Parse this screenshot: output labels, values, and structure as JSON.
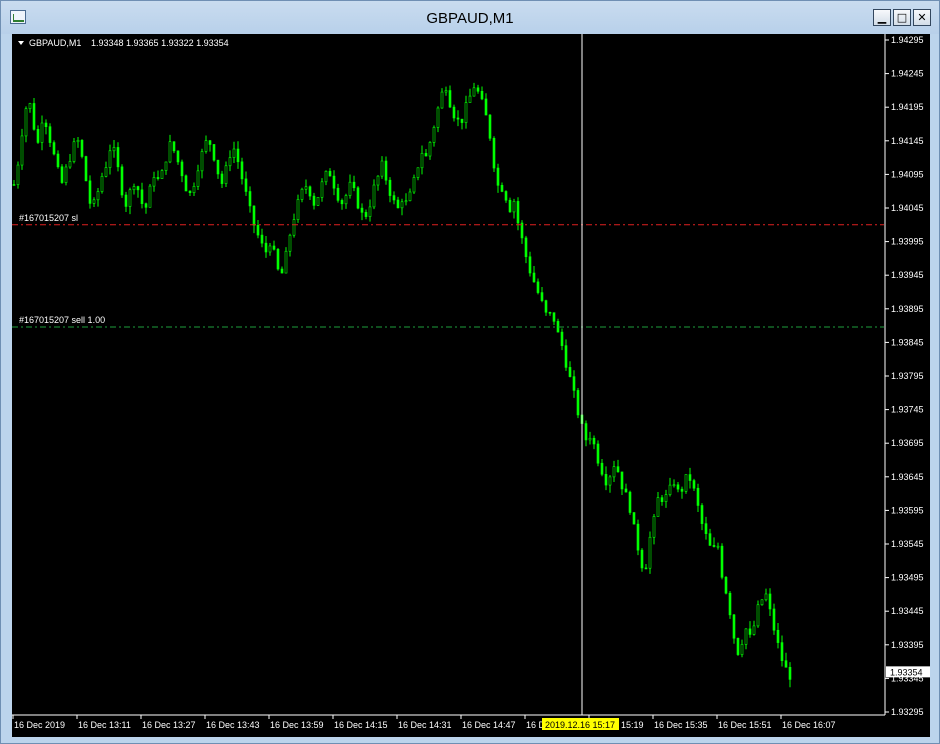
{
  "window": {
    "title": "GBPAUD,M1",
    "buttons": {
      "minimize": "▁",
      "maximize": "□",
      "close": "✕"
    }
  },
  "chart_header": {
    "symbol": "GBPAUD,M1",
    "ohlc": "1.93348 1.93365 1.93322 1.93354"
  },
  "order_lines": {
    "stop_loss": {
      "label": "#167015207 sl",
      "price": 1.9402,
      "color": "#e02020"
    },
    "entry": {
      "label": "#167015207 sell 1.00",
      "price": 1.93868,
      "color": "#1e9e3c"
    }
  },
  "crosshair": {
    "time_label": "2019.12.16 15:17",
    "label_bg": "#ffff00"
  },
  "bid_label": {
    "value": "1.93354"
  },
  "colors": {
    "background": "#000000",
    "candle": "#00ff00",
    "axis_text": "#ffffff",
    "crosshair": "#ffffff"
  },
  "chart_data": {
    "type": "candlestick",
    "symbol": "GBPAUD",
    "timeframe": "M1",
    "y_tick_labels": [
      "1.94295",
      "1.94245",
      "1.94195",
      "1.94145",
      "1.94095",
      "1.94045",
      "1.93995",
      "1.93945",
      "1.93895",
      "1.93845",
      "1.93795",
      "1.93745",
      "1.93695",
      "1.93645",
      "1.93595",
      "1.93545",
      "1.93495",
      "1.93445",
      "1.93395",
      "1.93345",
      "1.93295"
    ],
    "ylim": [
      1.9329,
      1.943
    ],
    "x_tick_labels": [
      "16 Dec 2019",
      "16 Dec 13:11",
      "16 Dec 13:27",
      "16 Dec 13:43",
      "16 Dec 13:59",
      "16 Dec 14:15",
      "16 Dec 14:31",
      "16 Dec 14:47",
      "16 Dec 15:03",
      "16 Dec 15:19",
      "16 Dec 15:35",
      "16 Dec 15:51",
      "16 Dec 16:07"
    ],
    "close_path": [
      1.9408,
      1.9412,
      1.9418,
      1.9421,
      1.9417,
      1.9414,
      1.9419,
      1.9416,
      1.9413,
      1.941,
      1.9408,
      1.9411,
      1.9413,
      1.9415,
      1.9412,
      1.9408,
      1.9404,
      1.9406,
      1.9409,
      1.9411,
      1.9414,
      1.9412,
      1.9408,
      1.9405,
      1.9407,
      1.9409,
      1.9406,
      1.9404,
      1.9407,
      1.941,
      1.9408,
      1.9411,
      1.9414,
      1.9413,
      1.9411,
      1.9409,
      1.9406,
      1.9408,
      1.9411,
      1.9413,
      1.9415,
      1.9413,
      1.941,
      1.9408,
      1.9411,
      1.9414,
      1.9412,
      1.9409,
      1.9406,
      1.9403,
      1.9401,
      1.9399,
      1.9398,
      1.94,
      1.9396,
      1.9394,
      1.9397,
      1.9401,
      1.9404,
      1.9406,
      1.9408,
      1.9407,
      1.9405,
      1.9407,
      1.9409,
      1.941,
      1.9408,
      1.9406,
      1.9405,
      1.9408,
      1.9407,
      1.9405,
      1.9403,
      1.9404,
      1.9407,
      1.9409,
      1.9411,
      1.9408,
      1.9406,
      1.9404,
      1.9406,
      1.9405,
      1.9407,
      1.941,
      1.9413,
      1.9412,
      1.9415,
      1.9418,
      1.9421,
      1.9423,
      1.942,
      1.9418,
      1.9417,
      1.9419,
      1.9421,
      1.9423,
      1.9421,
      1.9419,
      1.9416,
      1.9411,
      1.9407,
      1.9408,
      1.9404,
      1.9406,
      1.9402,
      1.9399,
      1.9396,
      1.9394,
      1.9392,
      1.939,
      1.9388,
      1.9389,
      1.9386,
      1.9384,
      1.9381,
      1.9378,
      1.9375,
      1.9372,
      1.937,
      1.9371,
      1.9368,
      1.9366,
      1.9364,
      1.9365,
      1.9367,
      1.9364,
      1.9362,
      1.936,
      1.9356,
      1.9353,
      1.935,
      1.9355,
      1.9358,
      1.9362,
      1.9361,
      1.9362,
      1.9364,
      1.9362,
      1.9363,
      1.9365,
      1.9363,
      1.936,
      1.9357,
      1.9355,
      1.9353,
      1.9355,
      1.935,
      1.9347,
      1.9343,
      1.9338,
      1.934,
      1.9342,
      1.934,
      1.9344,
      1.9346,
      1.9347,
      1.9344,
      1.9341,
      1.9338,
      1.9336,
      1.9335
    ]
  }
}
